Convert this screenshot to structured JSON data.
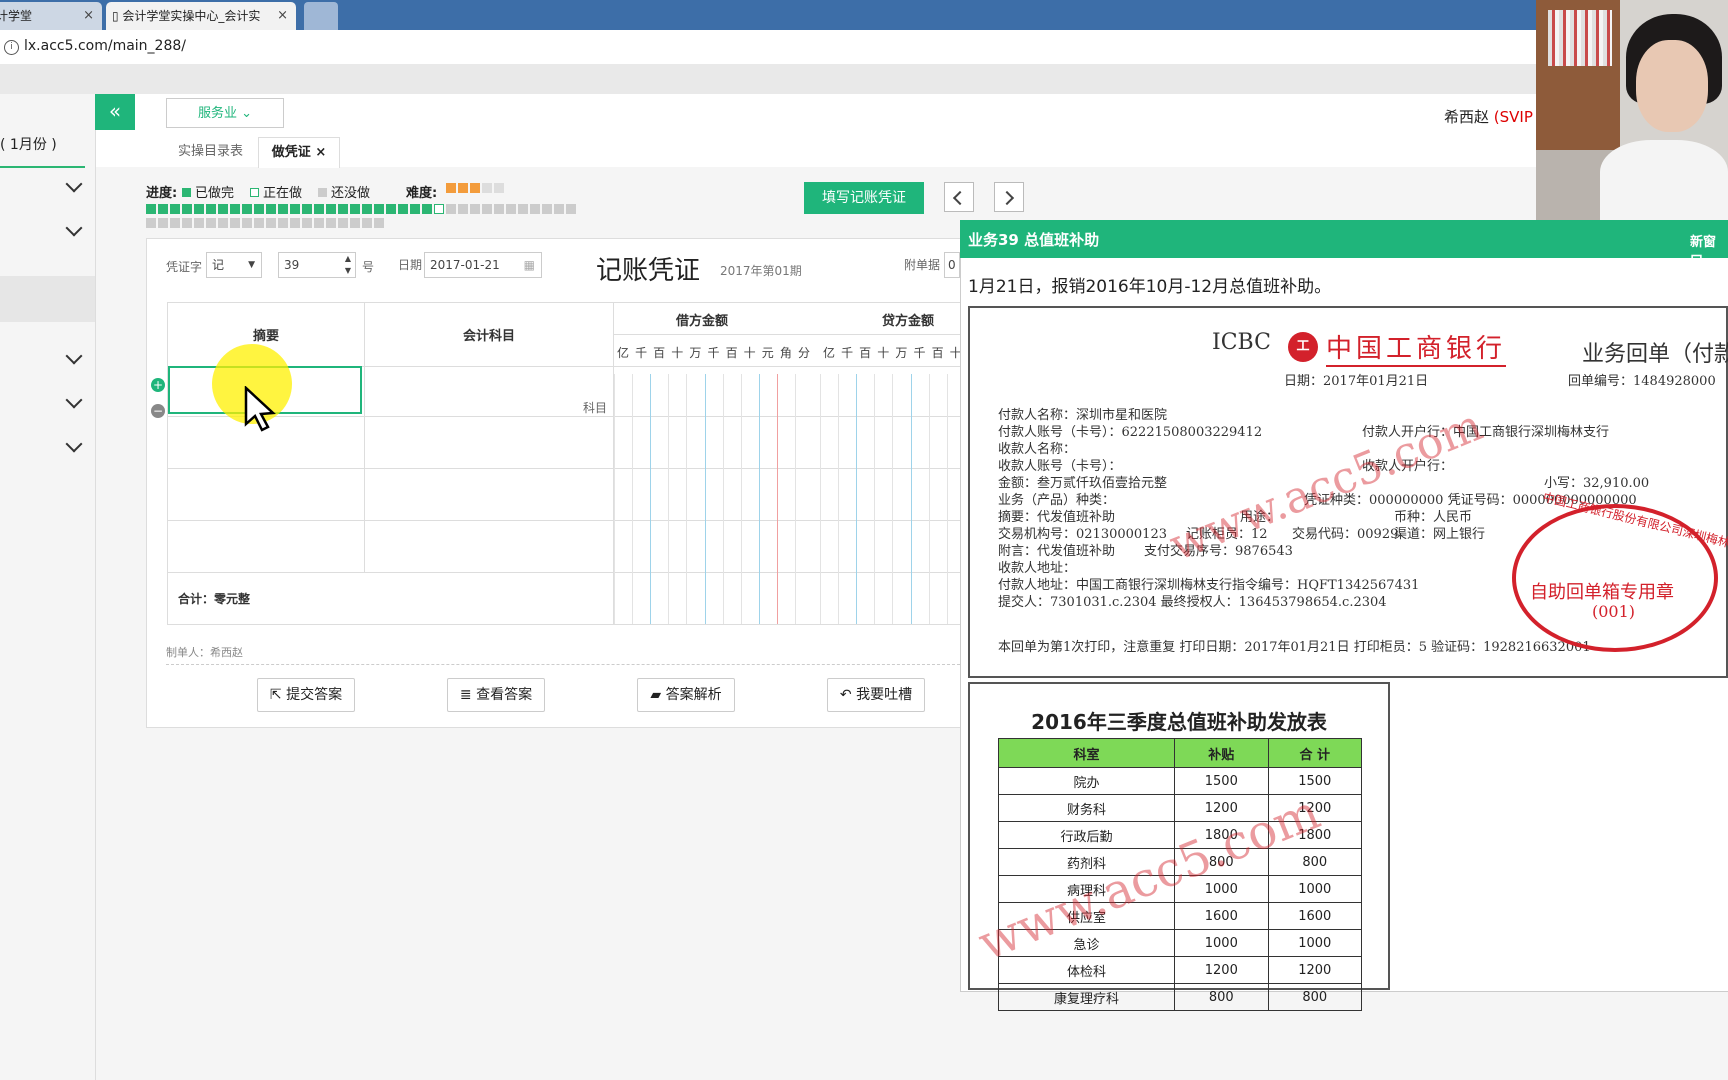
{
  "browser": {
    "tab1_title": "计学堂",
    "tab2_title": "会计学堂实操中心_会计实",
    "url": "lx.acc5.com/main_288/"
  },
  "app": {
    "industry_select": "服务业",
    "username": "希西赵",
    "vip_tag": "(SVIP",
    "sidebar_month": "( 1月份 )"
  },
  "tabs": [
    {
      "label": "实操目录表"
    },
    {
      "label": "做凭证",
      "close": "×"
    }
  ],
  "progress": {
    "label": "进度:",
    "legend_done": "已做完",
    "legend_doing": "正在做",
    "legend_todo": "还没做",
    "difficulty_label": "难度:",
    "difficulty_level": 3,
    "difficulty_max": 5,
    "done_count": 24,
    "current_index": 25,
    "total": 56,
    "colors": {
      "done": "#2bb673",
      "doing": "#ffffff",
      "todo": "#cccccc"
    }
  },
  "actions": {
    "fill_voucher": "填写记账凭证"
  },
  "voucher": {
    "word_label": "凭证字",
    "word_value": "记",
    "number_value": "39",
    "number_suffix": "号",
    "date_label": "日期",
    "date_value": "2017-01-21",
    "title": "记账凭证",
    "period": "2017年第01期",
    "attach_label": "附单据",
    "attach_value": "0",
    "col_summary": "摘要",
    "col_account": "会计科目",
    "col_debit": "借方金额",
    "col_credit": "贷方金额",
    "digit_units": [
      "亿",
      "千",
      "百",
      "十",
      "万",
      "千",
      "百",
      "十",
      "元",
      "角",
      "分"
    ],
    "account_hint": "科目",
    "total_label": "合计：零元整",
    "maker_label": "制单人：希西赵"
  },
  "buttons": {
    "submit": "提交答案",
    "view": "查看答案",
    "analysis": "答案解析",
    "feedback": "我要吐槽"
  },
  "task": {
    "title": "业务39 总值班补助",
    "new_window": "新窗口",
    "description": "1月21日，报销2016年10月-12月总值班补助。"
  },
  "receipt": {
    "bank_en": "ICBC",
    "bank_cn": "中国工商银行",
    "doc_title": "业务回单（付款",
    "date_line": "日期：2017年01月21日",
    "receipt_no": "回单编号：1484928000",
    "lines": [
      "付款人名称：深圳市星和医院",
      "付款人账号（卡号）：62221508003229412",
      "收款人名称：",
      "收款人账号（卡号）：",
      "金额：叁万贰仟玖佰壹拾元整",
      "业务（产品）种类：",
      "摘要：代发值班补助",
      "交易机构号：02130000123",
      "附言：代发值班补助",
      "收款人地址：",
      "付款人地址：中国工商银行深圳梅林支行指令编号：HQFT1342567431",
      "提交人：7301031.c.2304  最终授权人：136453798654.c.2304"
    ],
    "payer_bank": "付款人开户行：中国工商银行深圳梅林支行",
    "payee_bank": "收款人开户行：",
    "amount_small": "小写：32,910.00",
    "voucher_type": "凭证种类：000000000  凭证号码：000000000000000",
    "purpose": "用途：",
    "currency": "币种：人民币",
    "teller": "记账柜员：12",
    "trade_code": "交易代码：00929",
    "channel": "渠道：网上银行",
    "pay_seq": "支付交易序号：9876543",
    "footer": "本回单为第1次打印，注意重复  打印日期：2017年01月21日  打印柜员：5  验证码：1928216632001",
    "stamp_arc": "中国工商银行股份有限公司深圳梅林支行",
    "stamp_text": "自助回单箱专用章",
    "stamp_no": "(001)",
    "watermark": "www.acc5.com"
  },
  "subsidy_table": {
    "title": "2016年三季度总值班补助发放表",
    "headers": [
      "科室",
      "补贴",
      "合 计"
    ],
    "rows": [
      [
        "院办",
        "1500",
        "1500"
      ],
      [
        "财务科",
        "1200",
        "1200"
      ],
      [
        "行政后勤",
        "1800",
        "1800"
      ],
      [
        "药剂科",
        "800",
        "800"
      ],
      [
        "病理科",
        "1000",
        "1000"
      ],
      [
        "供应室",
        "1600",
        "1600"
      ],
      [
        "急诊",
        "1000",
        "1000"
      ],
      [
        "体检科",
        "1200",
        "1200"
      ],
      [
        "康复理疗科",
        "800",
        "800"
      ]
    ]
  }
}
